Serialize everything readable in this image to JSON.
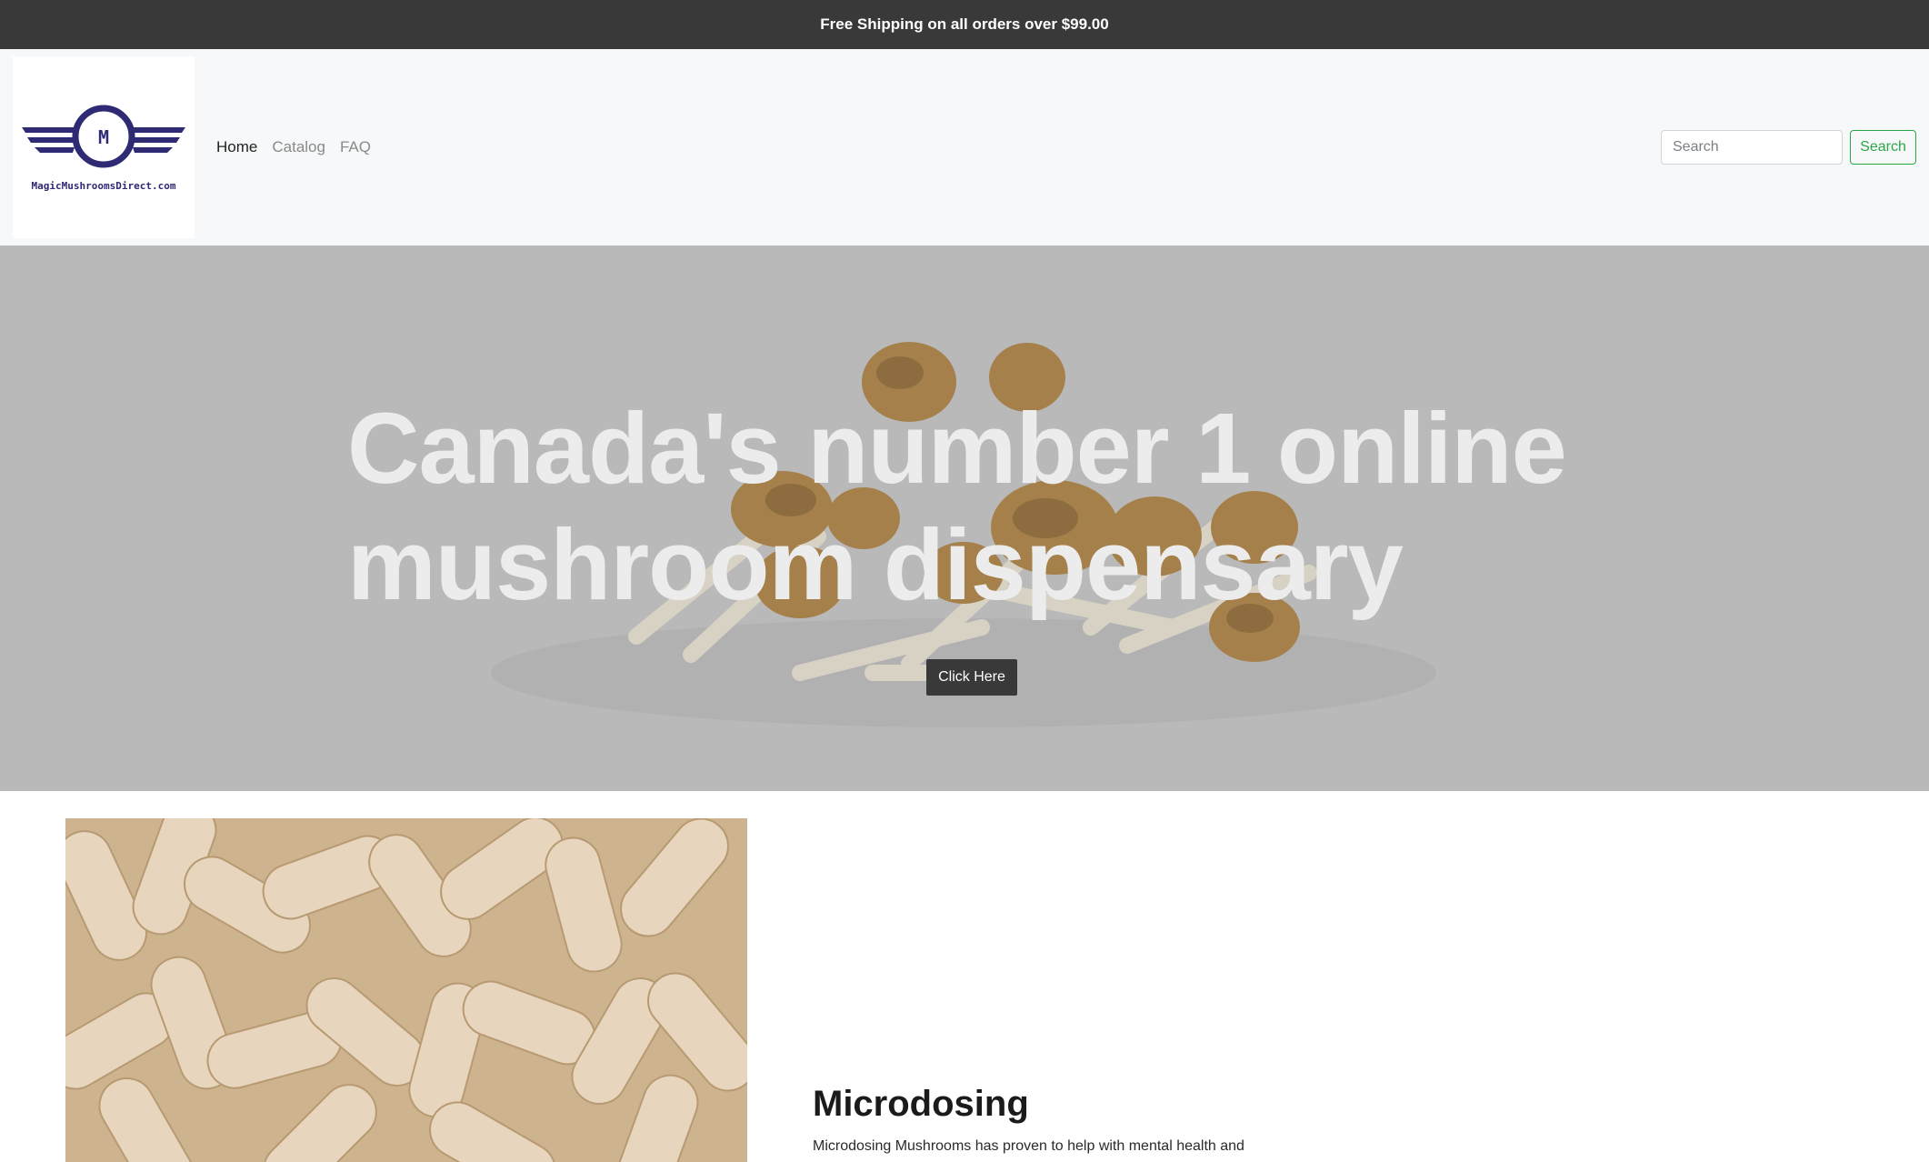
{
  "announcement": "Free Shipping on all orders over $99.00",
  "brand": {
    "logo_letter": "M",
    "logo_text": "MagicMushroomsDirect.com",
    "color": "#2e2a73"
  },
  "nav": {
    "items": [
      {
        "label": "Home",
        "active": true
      },
      {
        "label": "Catalog",
        "active": false
      },
      {
        "label": "FAQ",
        "active": false
      }
    ]
  },
  "search": {
    "placeholder": "Search",
    "button_label": "Search",
    "button_color": "#28a745"
  },
  "hero": {
    "title": "Canada's number 1 online mushroom dispensary",
    "button_label": "Click Here"
  },
  "feature": {
    "title": "Microdosing",
    "text": "Microdosing Mushrooms has proven to help with mental health and"
  }
}
